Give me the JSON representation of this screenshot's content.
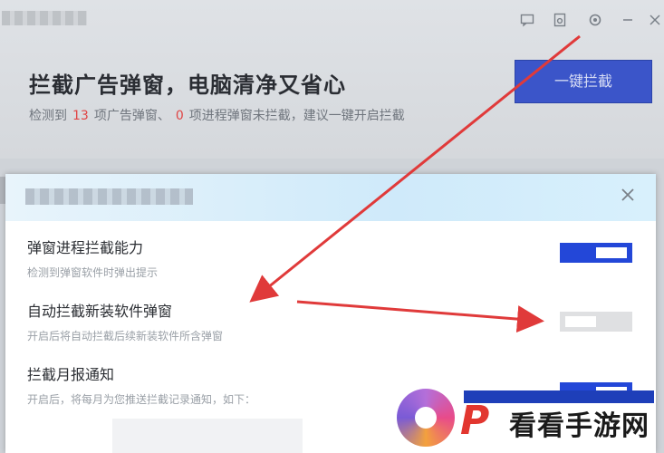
{
  "window": {
    "controls": {
      "feedback": "feedback-icon",
      "skin": "skin-icon",
      "settings": "gear-icon",
      "minimize": "minimize-icon",
      "close": "close-icon"
    }
  },
  "hero": {
    "title": "拦截广告弹窗，电脑清净又省心",
    "subtitle_before": "检测到",
    "ad_popup_count": "13",
    "subtitle_mid": "项广告弹窗、",
    "process_popup_count": "0",
    "subtitle_after": "项进程弹窗未拦截，建议一键开启拦截",
    "action_label": "一键拦截"
  },
  "dialog": {
    "close_icon": "close-icon",
    "settings": [
      {
        "title": "弹窗进程拦截能力",
        "desc": "检测到弹窗软件时弹出提示",
        "enabled": true
      },
      {
        "title": "自动拦截新装软件弹窗",
        "desc": "开启后将自动拦截后续新装软件所含弹窗",
        "enabled": false
      },
      {
        "title": "拦截月报通知",
        "desc": "开启后，将每月为您推送拦截记录通知，如下：",
        "enabled": true
      }
    ]
  },
  "colors": {
    "accent": "#2347d8",
    "alert": "#e04545",
    "annotation_arrow": "#e03a3a"
  },
  "watermark": {
    "text": "看看手游网"
  }
}
